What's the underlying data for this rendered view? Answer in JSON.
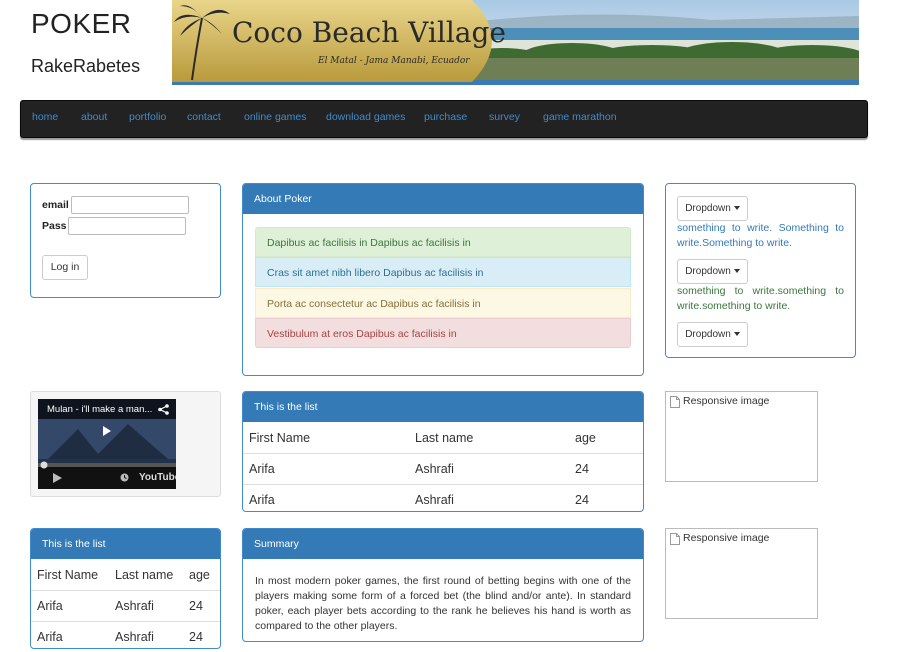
{
  "header": {
    "title": "POKER",
    "subtitle": "RakeRabetes",
    "banner_title": "Coco Beach Village",
    "banner_subtitle": "El Matal - Jama Manabi, Ecuador"
  },
  "nav": {
    "items": [
      "home",
      "about",
      "portfolio",
      "contact",
      "online games",
      "download games",
      "purchase",
      "survey",
      "game marathon"
    ]
  },
  "login": {
    "email_label": "email",
    "pass_label": "Pass",
    "email_value": "",
    "pass_value": "",
    "button": "Log in"
  },
  "about": {
    "heading": "About Poker",
    "alerts": [
      "Dapibus ac facilisis in Dapibus ac facilisis in",
      "Cras sit amet nibh libero Dapibus ac facilisis in",
      "Porta ac consectetur ac Dapibus ac facilisis in",
      "Vestibulum at eros Dapibus ac facilisis in"
    ]
  },
  "dropdowns": {
    "label": "Dropdown",
    "text1": "something to write. Something to write.Something to write.",
    "text2": "something to write.something to write.something to write."
  },
  "video": {
    "title": "Mulan - i'll make a man...",
    "youtube_label": "YouTube"
  },
  "list_main": {
    "heading": "This is the list",
    "columns": [
      "First Name",
      "Last name",
      "age"
    ],
    "rows": [
      [
        "Arifa",
        "Ashrafi",
        "24"
      ],
      [
        "Arifa",
        "Ashrafi",
        "24"
      ]
    ]
  },
  "list_side": {
    "heading": "This is the list",
    "columns": [
      "First Name",
      "Last name",
      "age"
    ],
    "rows": [
      [
        "Arifa",
        "Ashrafi",
        "24"
      ],
      [
        "Arifa",
        "Ashrafi",
        "24"
      ]
    ]
  },
  "images": {
    "alt1": "Responsive image",
    "alt2": "Responsive image"
  },
  "summary": {
    "heading": "Summary",
    "text": "In most modern poker games, the first round of betting begins with one of the players making some form of a forced bet (the blind and/or ante). In standard poker, each player bets according to the rank he believes his hand is worth as compared to the other players."
  },
  "colors": {
    "primary": "#337ab7",
    "navbar": "#222222",
    "link": "#428bca"
  }
}
